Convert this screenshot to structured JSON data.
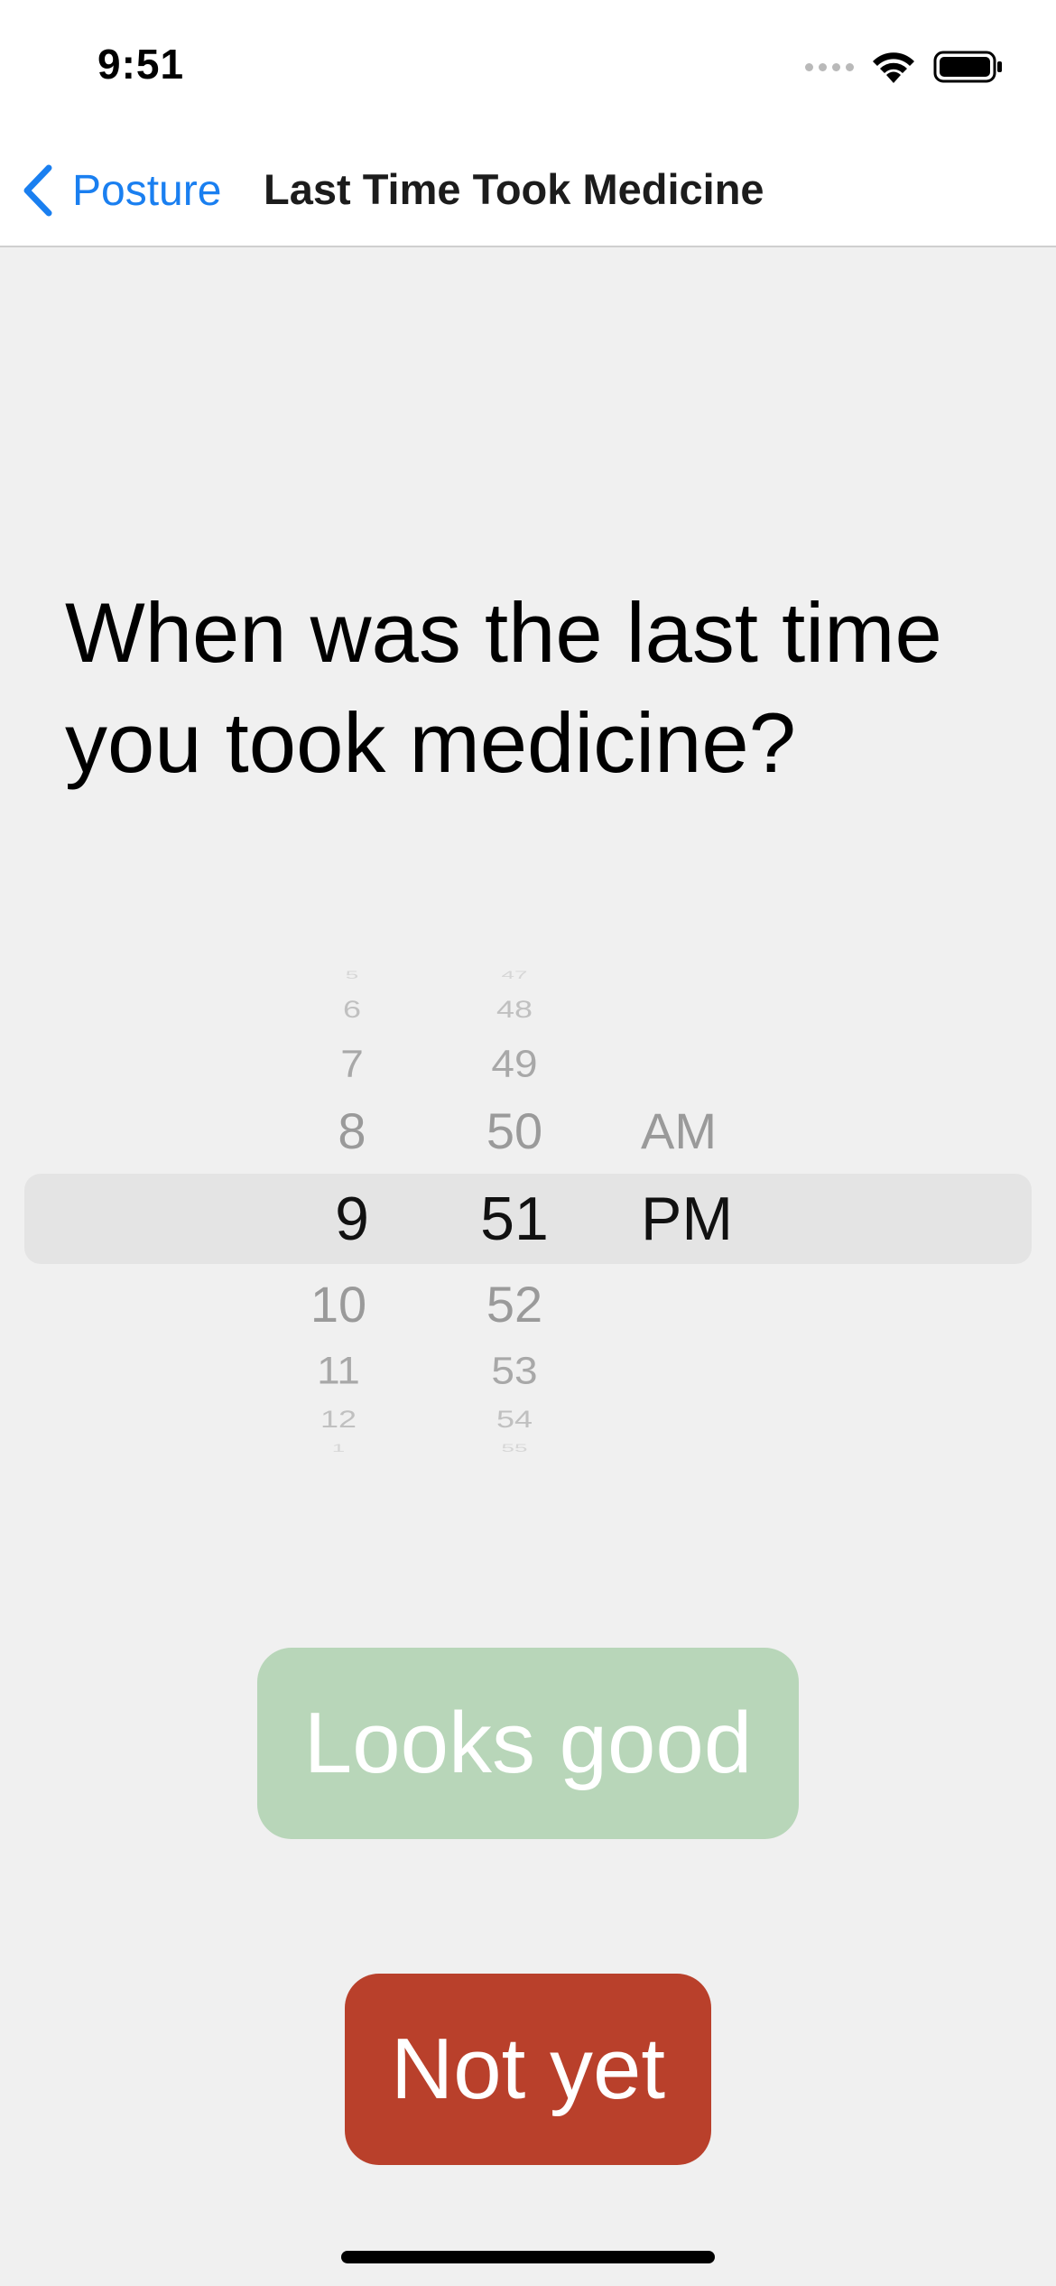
{
  "status_bar": {
    "time": "9:51",
    "icons": [
      "cellular-signal-icon",
      "wifi-icon",
      "battery-icon"
    ]
  },
  "nav": {
    "back_label": "Posture",
    "title": "Last Time Took Medicine",
    "accent_color": "#1a7ff0"
  },
  "question": {
    "line1": "When was the last time",
    "line2": "you took medicine?"
  },
  "picker": {
    "hour": {
      "above": [
        "5",
        "6",
        "7",
        "8"
      ],
      "selected": "9",
      "below": [
        "10",
        "11",
        "12",
        "1"
      ]
    },
    "minute": {
      "above": [
        "47",
        "48",
        "49",
        "50"
      ],
      "selected": "51",
      "below": [
        "52",
        "53",
        "54",
        "55"
      ]
    },
    "period": {
      "above": [
        "AM"
      ],
      "selected": "PM"
    }
  },
  "buttons": {
    "looks_good": "Looks good",
    "looks_good_color": "#b8d6b9",
    "not_yet": "Not yet",
    "not_yet_color": "#b9402b"
  }
}
